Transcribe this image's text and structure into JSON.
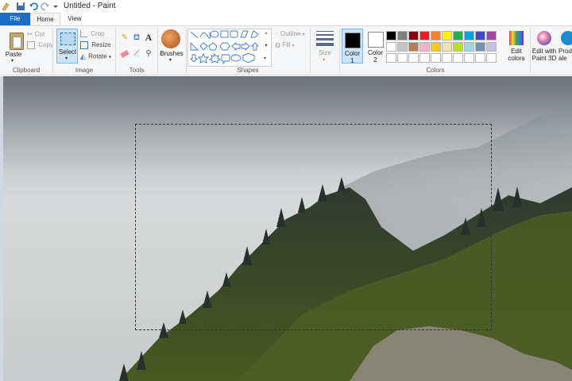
{
  "window": {
    "title": "Untitled - Paint"
  },
  "tabs": {
    "file": "File",
    "home": "Home",
    "view": "View"
  },
  "clipboard": {
    "paste": "Paste",
    "cut": "Cut",
    "copy": "Copy",
    "label": "Clipboard"
  },
  "image": {
    "select": "Select",
    "crop": "Crop",
    "resize": "Resize",
    "rotate": "Rotate",
    "label": "Image"
  },
  "tools": {
    "label": "Tools",
    "text_tool": "A"
  },
  "brushes": {
    "label": "Brushes"
  },
  "shapes": {
    "label": "Shapes",
    "outline": "Outline",
    "fill": "Fill"
  },
  "size": {
    "label": "Size"
  },
  "colors": {
    "color1_label": "Color",
    "color1_num": "1",
    "color2_label": "Color",
    "color2_num": "2",
    "edit_colors_l1": "Edit",
    "edit_colors_l2": "colors",
    "label": "Colors",
    "color1": "#000000",
    "color2": "#ffffff",
    "palette_row1": [
      "#000000",
      "#7f7f7f",
      "#880015",
      "#ed1c24",
      "#ff7f27",
      "#fff200",
      "#22b14c",
      "#00a2e8",
      "#3f48cc",
      "#a349a4"
    ],
    "palette_row2": [
      "#ffffff",
      "#c3c3c3",
      "#b97a57",
      "#ffaec9",
      "#ffc90e",
      "#efe4b0",
      "#b5e61d",
      "#99d9ea",
      "#7092be",
      "#c8bfe7"
    ],
    "palette_row3": [
      "#ffffff",
      "#ffffff",
      "#ffffff",
      "#ffffff",
      "#ffffff",
      "#ffffff",
      "#ffffff",
      "#ffffff",
      "#ffffff",
      "#ffffff"
    ]
  },
  "paint3d": {
    "l1": "Edit with",
    "l2": "Paint 3D"
  },
  "product_alert": {
    "l1": "Prod",
    "l2": "ale"
  }
}
